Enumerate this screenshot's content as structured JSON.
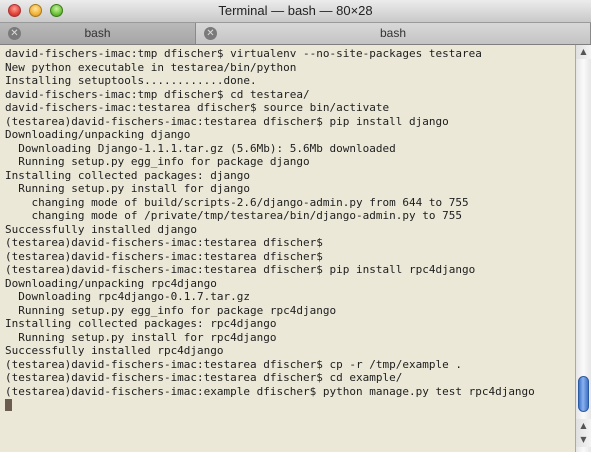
{
  "window": {
    "title": "Terminal — bash — 80×28"
  },
  "tabs": [
    {
      "label": "bash",
      "active": false
    },
    {
      "label": "bash",
      "active": true
    }
  ],
  "terminal": {
    "lines": [
      "david-fischers-imac:tmp dfischer$ virtualenv --no-site-packages testarea",
      "New python executable in testarea/bin/python",
      "Installing setuptools............done.",
      "david-fischers-imac:tmp dfischer$ cd testarea/",
      "david-fischers-imac:testarea dfischer$ source bin/activate",
      "(testarea)david-fischers-imac:testarea dfischer$ pip install django",
      "Downloading/unpacking django",
      "  Downloading Django-1.1.1.tar.gz (5.6Mb): 5.6Mb downloaded",
      "  Running setup.py egg_info for package django",
      "Installing collected packages: django",
      "  Running setup.py install for django",
      "    changing mode of build/scripts-2.6/django-admin.py from 644 to 755",
      "    changing mode of /private/tmp/testarea/bin/django-admin.py to 755",
      "Successfully installed django",
      "(testarea)david-fischers-imac:testarea dfischer$",
      "(testarea)david-fischers-imac:testarea dfischer$",
      "(testarea)david-fischers-imac:testarea dfischer$ pip install rpc4django",
      "Downloading/unpacking rpc4django",
      "  Downloading rpc4django-0.1.7.tar.gz",
      "  Running setup.py egg_info for package rpc4django",
      "Installing collected packages: rpc4django",
      "  Running setup.py install for rpc4django",
      "Successfully installed rpc4django",
      "(testarea)david-fischers-imac:testarea dfischer$ cp -r /tmp/example .",
      "(testarea)david-fischers-imac:testarea dfischer$ cd example/",
      "(testarea)david-fischers-imac:example dfischer$ python manage.py test rpc4django"
    ]
  },
  "icons": {
    "close": "close-window-icon",
    "minimize": "minimize-window-icon",
    "zoom": "zoom-window-icon",
    "tab_close": "tab-close-icon",
    "scroll_up": "scroll-up-arrow-icon",
    "scroll_down": "scroll-down-arrow-icon"
  },
  "colors": {
    "terminal_background": "#ebe8d8",
    "terminal_text": "#1d1d1d",
    "scroll_thumb": "#3f73c7"
  }
}
